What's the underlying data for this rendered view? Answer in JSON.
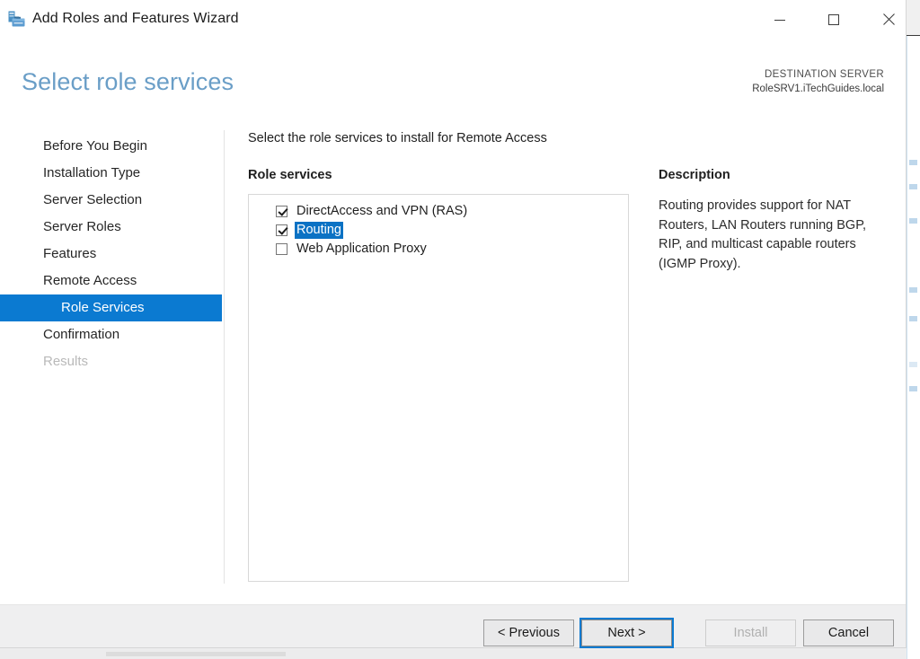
{
  "window": {
    "title": "Add Roles and Features Wizard",
    "icon": "server-roles-icon",
    "controls": {
      "minimize": "minimize-icon",
      "maximize": "maximize-icon",
      "close": "close-icon"
    }
  },
  "header": {
    "page_title": "Select role services",
    "destination_label": "DESTINATION SERVER",
    "destination_server": "RoleSRV1.iTechGuides.local"
  },
  "nav": {
    "items": [
      {
        "label": "Before You Begin",
        "state": "normal",
        "indent": false
      },
      {
        "label": "Installation Type",
        "state": "normal",
        "indent": false
      },
      {
        "label": "Server Selection",
        "state": "normal",
        "indent": false
      },
      {
        "label": "Server Roles",
        "state": "normal",
        "indent": false
      },
      {
        "label": "Features",
        "state": "normal",
        "indent": false
      },
      {
        "label": "Remote Access",
        "state": "normal",
        "indent": false
      },
      {
        "label": "Role Services",
        "state": "selected",
        "indent": true
      },
      {
        "label": "Confirmation",
        "state": "normal",
        "indent": false
      },
      {
        "label": "Results",
        "state": "disabled",
        "indent": false
      }
    ]
  },
  "main": {
    "intro": "Select the role services to install for Remote Access",
    "role_services_label": "Role services",
    "description_label": "Description",
    "description_text": "Routing provides support for NAT Routers, LAN Routers running BGP, RIP, and multicast capable routers (IGMP Proxy).",
    "role_services": [
      {
        "label": "DirectAccess and VPN (RAS)",
        "checked": true,
        "selected": false
      },
      {
        "label": "Routing",
        "checked": true,
        "selected": true
      },
      {
        "label": "Web Application Proxy",
        "checked": false,
        "selected": false
      }
    ]
  },
  "footer": {
    "previous_label": "< Previous",
    "next_label": "Next >",
    "install_label": "Install",
    "cancel_label": "Cancel",
    "install_disabled": true,
    "next_focused": true
  },
  "colors": {
    "accent_blue": "#0b7ad1",
    "title_blue": "#6a9ec7",
    "selection_blue": "#0b72c4",
    "footer_gray": "#efeff0",
    "disabled_text": "#b9b9b9"
  }
}
